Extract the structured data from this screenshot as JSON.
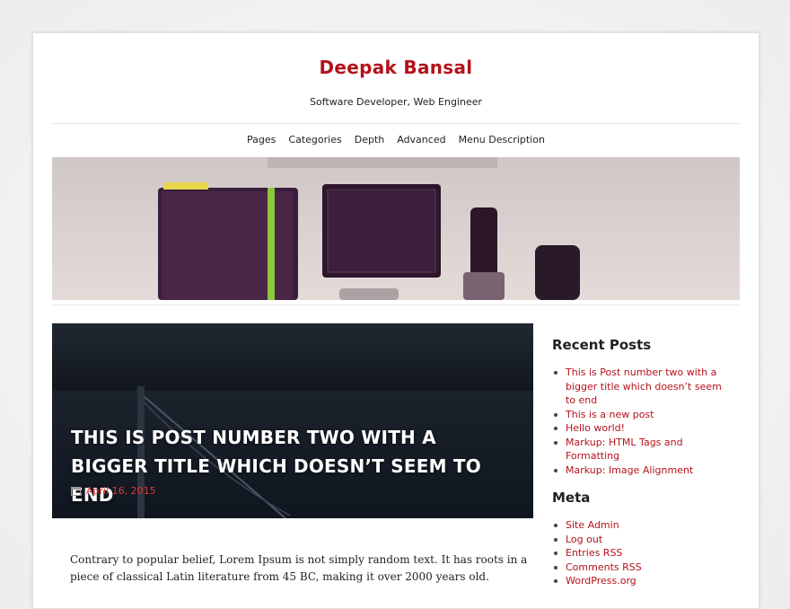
{
  "site": {
    "title": "Deepak Bansal",
    "description": "Software Developer, Web Engineer"
  },
  "nav": {
    "items": [
      "Pages",
      "Categories",
      "Depth",
      "Advanced",
      "Menu Description"
    ]
  },
  "post": {
    "title": "This is Post number two with a bigger title which doesn’t seem to end",
    "date": "April 16, 2015",
    "excerpt": "Contrary to popular belief, Lorem Ipsum is not simply random text. It has roots in a piece of classical Latin literature from 45 BC, making it over 2000 years old."
  },
  "sidebar": {
    "recent_posts": {
      "title": "Recent Posts",
      "items": [
        "This is Post number two with a bigger title which doesn’t seem to end",
        "This is a new post",
        "Hello world!",
        "Markup: HTML Tags and Formatting",
        "Markup: Image Alignment"
      ]
    },
    "meta": {
      "title": "Meta",
      "items": [
        "Site Admin",
        "Log out",
        "Entries RSS",
        "Comments RSS",
        "WordPress.org"
      ]
    }
  },
  "colors": {
    "accent": "#b5121b",
    "date": "#e03a3a"
  }
}
